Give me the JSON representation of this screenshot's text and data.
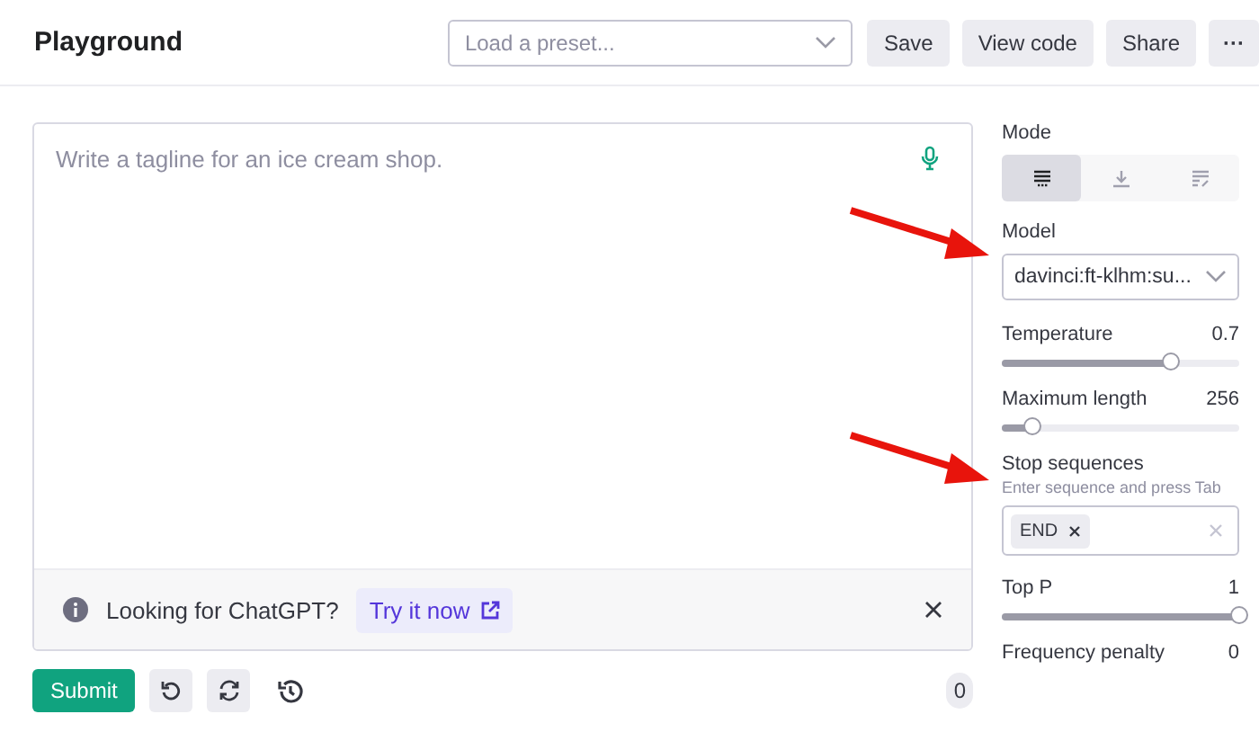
{
  "header": {
    "title": "Playground",
    "preset": {
      "placeholder": "Load a preset..."
    },
    "buttons": [
      {
        "kind": "text",
        "label": "Save"
      },
      {
        "kind": "text",
        "label": "View code"
      },
      {
        "kind": "text",
        "label": "Share"
      },
      {
        "kind": "more",
        "label": "···"
      }
    ]
  },
  "editor": {
    "placeholder": "Write a tagline for an ice cream shop.",
    "banner": {
      "text": "Looking for ChatGPT?",
      "link": "Try it now"
    },
    "submit": "Submit",
    "token_count": "0"
  },
  "sidebar": {
    "mode": {
      "label": "Mode",
      "options": [
        {
          "kind": "complete",
          "selected": true
        },
        {
          "kind": "insert",
          "selected": false
        },
        {
          "kind": "edit",
          "selected": false
        }
      ]
    },
    "model": {
      "label": "Model",
      "value": "davinci:ft-klhm:su...",
      "annotated": true
    },
    "parameters": [
      {
        "label": "Temperature",
        "reading": "0.7",
        "level": 0.71
      },
      {
        "label": "Maximum length",
        "reading": "256",
        "level": 0.13
      }
    ],
    "stop_sequences": {
      "label": "Stop sequences",
      "hint": "Enter sequence and press Tab",
      "tokens": [
        "END"
      ],
      "annotated": true
    },
    "more_parameters": [
      {
        "label": "Top P",
        "reading": "1",
        "level": 1
      },
      {
        "label": "Frequency penalty",
        "reading": "0"
      }
    ]
  }
}
